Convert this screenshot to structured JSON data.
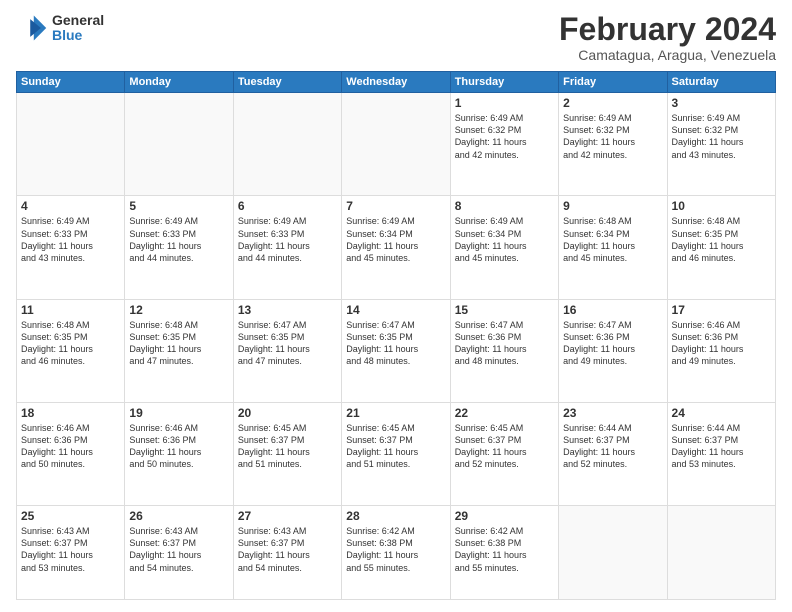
{
  "header": {
    "logo_general": "General",
    "logo_blue": "Blue",
    "month_title": "February 2024",
    "location": "Camatagua, Aragua, Venezuela"
  },
  "weekdays": [
    "Sunday",
    "Monday",
    "Tuesday",
    "Wednesday",
    "Thursday",
    "Friday",
    "Saturday"
  ],
  "weeks": [
    [
      {
        "day": "",
        "info": ""
      },
      {
        "day": "",
        "info": ""
      },
      {
        "day": "",
        "info": ""
      },
      {
        "day": "",
        "info": ""
      },
      {
        "day": "1",
        "info": "Sunrise: 6:49 AM\nSunset: 6:32 PM\nDaylight: 11 hours\nand 42 minutes."
      },
      {
        "day": "2",
        "info": "Sunrise: 6:49 AM\nSunset: 6:32 PM\nDaylight: 11 hours\nand 42 minutes."
      },
      {
        "day": "3",
        "info": "Sunrise: 6:49 AM\nSunset: 6:32 PM\nDaylight: 11 hours\nand 43 minutes."
      }
    ],
    [
      {
        "day": "4",
        "info": "Sunrise: 6:49 AM\nSunset: 6:33 PM\nDaylight: 11 hours\nand 43 minutes."
      },
      {
        "day": "5",
        "info": "Sunrise: 6:49 AM\nSunset: 6:33 PM\nDaylight: 11 hours\nand 44 minutes."
      },
      {
        "day": "6",
        "info": "Sunrise: 6:49 AM\nSunset: 6:33 PM\nDaylight: 11 hours\nand 44 minutes."
      },
      {
        "day": "7",
        "info": "Sunrise: 6:49 AM\nSunset: 6:34 PM\nDaylight: 11 hours\nand 45 minutes."
      },
      {
        "day": "8",
        "info": "Sunrise: 6:49 AM\nSunset: 6:34 PM\nDaylight: 11 hours\nand 45 minutes."
      },
      {
        "day": "9",
        "info": "Sunrise: 6:48 AM\nSunset: 6:34 PM\nDaylight: 11 hours\nand 45 minutes."
      },
      {
        "day": "10",
        "info": "Sunrise: 6:48 AM\nSunset: 6:35 PM\nDaylight: 11 hours\nand 46 minutes."
      }
    ],
    [
      {
        "day": "11",
        "info": "Sunrise: 6:48 AM\nSunset: 6:35 PM\nDaylight: 11 hours\nand 46 minutes."
      },
      {
        "day": "12",
        "info": "Sunrise: 6:48 AM\nSunset: 6:35 PM\nDaylight: 11 hours\nand 47 minutes."
      },
      {
        "day": "13",
        "info": "Sunrise: 6:47 AM\nSunset: 6:35 PM\nDaylight: 11 hours\nand 47 minutes."
      },
      {
        "day": "14",
        "info": "Sunrise: 6:47 AM\nSunset: 6:35 PM\nDaylight: 11 hours\nand 48 minutes."
      },
      {
        "day": "15",
        "info": "Sunrise: 6:47 AM\nSunset: 6:36 PM\nDaylight: 11 hours\nand 48 minutes."
      },
      {
        "day": "16",
        "info": "Sunrise: 6:47 AM\nSunset: 6:36 PM\nDaylight: 11 hours\nand 49 minutes."
      },
      {
        "day": "17",
        "info": "Sunrise: 6:46 AM\nSunset: 6:36 PM\nDaylight: 11 hours\nand 49 minutes."
      }
    ],
    [
      {
        "day": "18",
        "info": "Sunrise: 6:46 AM\nSunset: 6:36 PM\nDaylight: 11 hours\nand 50 minutes."
      },
      {
        "day": "19",
        "info": "Sunrise: 6:46 AM\nSunset: 6:36 PM\nDaylight: 11 hours\nand 50 minutes."
      },
      {
        "day": "20",
        "info": "Sunrise: 6:45 AM\nSunset: 6:37 PM\nDaylight: 11 hours\nand 51 minutes."
      },
      {
        "day": "21",
        "info": "Sunrise: 6:45 AM\nSunset: 6:37 PM\nDaylight: 11 hours\nand 51 minutes."
      },
      {
        "day": "22",
        "info": "Sunrise: 6:45 AM\nSunset: 6:37 PM\nDaylight: 11 hours\nand 52 minutes."
      },
      {
        "day": "23",
        "info": "Sunrise: 6:44 AM\nSunset: 6:37 PM\nDaylight: 11 hours\nand 52 minutes."
      },
      {
        "day": "24",
        "info": "Sunrise: 6:44 AM\nSunset: 6:37 PM\nDaylight: 11 hours\nand 53 minutes."
      }
    ],
    [
      {
        "day": "25",
        "info": "Sunrise: 6:43 AM\nSunset: 6:37 PM\nDaylight: 11 hours\nand 53 minutes."
      },
      {
        "day": "26",
        "info": "Sunrise: 6:43 AM\nSunset: 6:37 PM\nDaylight: 11 hours\nand 54 minutes."
      },
      {
        "day": "27",
        "info": "Sunrise: 6:43 AM\nSunset: 6:37 PM\nDaylight: 11 hours\nand 54 minutes."
      },
      {
        "day": "28",
        "info": "Sunrise: 6:42 AM\nSunset: 6:38 PM\nDaylight: 11 hours\nand 55 minutes."
      },
      {
        "day": "29",
        "info": "Sunrise: 6:42 AM\nSunset: 6:38 PM\nDaylight: 11 hours\nand 55 minutes."
      },
      {
        "day": "",
        "info": ""
      },
      {
        "day": "",
        "info": ""
      }
    ]
  ]
}
